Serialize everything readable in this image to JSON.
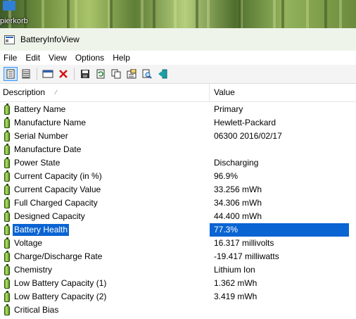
{
  "desktop": {
    "label": "pierkorb"
  },
  "window": {
    "title": "BatteryInfoView"
  },
  "menu": [
    "File",
    "Edit",
    "View",
    "Options",
    "Help"
  ],
  "toolbar": {
    "buttons": [
      {
        "icon": "html-report-icon",
        "active": true
      },
      {
        "icon": "list-view-icon"
      },
      {
        "icon": "advanced-options-icon"
      },
      {
        "icon": "delete-icon"
      },
      {
        "icon": "save-icon"
      },
      {
        "icon": "refresh-icon"
      },
      {
        "icon": "copy-icon"
      },
      {
        "icon": "properties-icon"
      },
      {
        "icon": "find-icon"
      },
      {
        "icon": "exit-icon"
      }
    ]
  },
  "columns": {
    "description": "Description",
    "value": "Value"
  },
  "rows": [
    {
      "description": "Battery Name",
      "value": "Primary"
    },
    {
      "description": "Manufacture Name",
      "value": "Hewlett-Packard"
    },
    {
      "description": "Serial Number",
      "value": "06300 2016/02/17"
    },
    {
      "description": "Manufacture Date",
      "value": ""
    },
    {
      "description": "Power State",
      "value": "Discharging"
    },
    {
      "description": "Current Capacity (in %)",
      "value": "96.9%"
    },
    {
      "description": "Current Capacity Value",
      "value": "33.256 mWh"
    },
    {
      "description": "Full Charged Capacity",
      "value": "34.306 mWh"
    },
    {
      "description": "Designed Capacity",
      "value": "44.400 mWh"
    },
    {
      "description": "Battery Health",
      "value": "77.3%",
      "selected": true
    },
    {
      "description": "Voltage",
      "value": "16.317 millivolts"
    },
    {
      "description": "Charge/Discharge Rate",
      "value": "-19.417 milliwatts"
    },
    {
      "description": "Chemistry",
      "value": "Lithium Ion"
    },
    {
      "description": "Low Battery Capacity (1)",
      "value": "1.362 mWh"
    },
    {
      "description": "Low Battery Capacity (2)",
      "value": "3.419 mWh"
    },
    {
      "description": "Critical Bias",
      "value": ""
    }
  ]
}
